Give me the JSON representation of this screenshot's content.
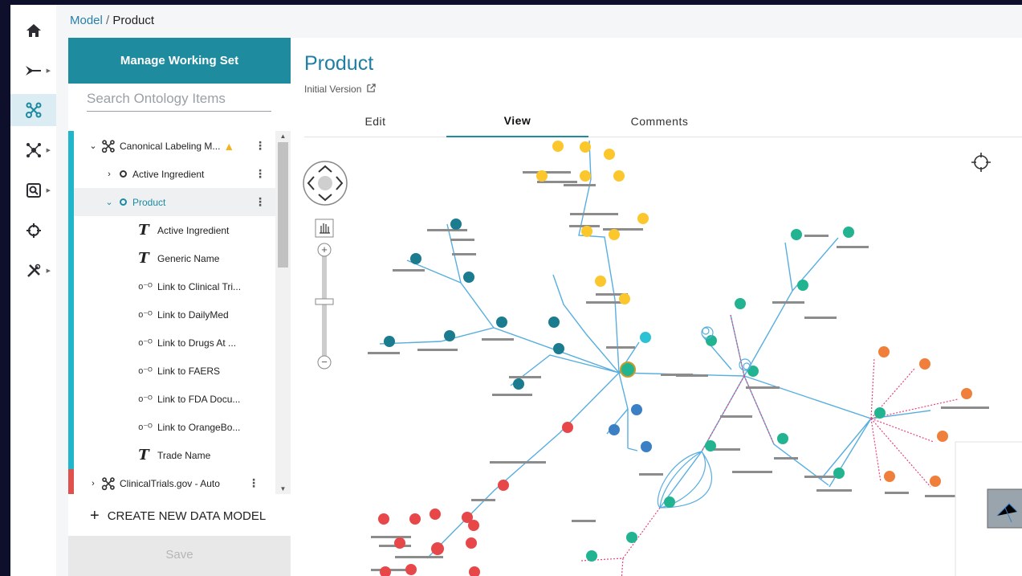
{
  "breadcrumb": {
    "parent": "Model",
    "separator": "/",
    "current": "Product"
  },
  "rail": [
    {
      "icon": "home-icon",
      "glyph": "🏠",
      "caret": false
    },
    {
      "icon": "pipeline-icon",
      "glyph": "➣",
      "caret": true
    },
    {
      "icon": "ontology-icon",
      "glyph": "⛓",
      "caret": false,
      "active": true
    },
    {
      "icon": "network-icon",
      "glyph": "✺",
      "caret": true
    },
    {
      "icon": "search-doc-icon",
      "glyph": "⎘",
      "caret": true
    },
    {
      "icon": "crosshair-icon",
      "glyph": "⌖",
      "caret": false
    },
    {
      "icon": "tools-icon",
      "glyph": "✂",
      "caret": true
    }
  ],
  "working_set": {
    "header": "Manage Working Set",
    "search_placeholder": "Search Ontology Items",
    "items": [
      {
        "label": "Canonical Labeling M...",
        "type": "model",
        "expanded": true,
        "warning": true
      },
      {
        "label": "Active Ingredient",
        "type": "object",
        "expanded": false
      },
      {
        "label": "Product",
        "type": "object",
        "expanded": true,
        "selected": true
      },
      {
        "label": "Active Ingredient",
        "type": "text"
      },
      {
        "label": "Generic Name",
        "type": "text"
      },
      {
        "label": "Link to Clinical Tri...",
        "type": "link"
      },
      {
        "label": "Link to DailyMed",
        "type": "link"
      },
      {
        "label": "Link to Drugs At ...",
        "type": "link"
      },
      {
        "label": "Link to FAERS",
        "type": "link"
      },
      {
        "label": "Link to FDA Docu...",
        "type": "link"
      },
      {
        "label": "Link to OrangeBo...",
        "type": "link"
      },
      {
        "label": "Trade Name",
        "type": "text"
      },
      {
        "label": "ClinicalTrials.gov - Auto",
        "type": "model",
        "expanded": false
      }
    ],
    "create_label": "CREATE NEW DATA MODEL",
    "save_label": "Save"
  },
  "main": {
    "title": "Product",
    "version": "Initial Version",
    "tabs": [
      "Edit",
      "View",
      "Comments"
    ],
    "active_tab": "View"
  },
  "colors": {
    "teal": "#1e8b9e",
    "yellow": "#fcc72c",
    "dark_teal": "#1b7b8f",
    "green": "#22b391",
    "orange": "#f07f3c",
    "red": "#e8474a",
    "blue": "#3b7fc4",
    "cyan": "#2bc3d4",
    "edge": "#57aee0",
    "link_edge": "#e8447a"
  }
}
